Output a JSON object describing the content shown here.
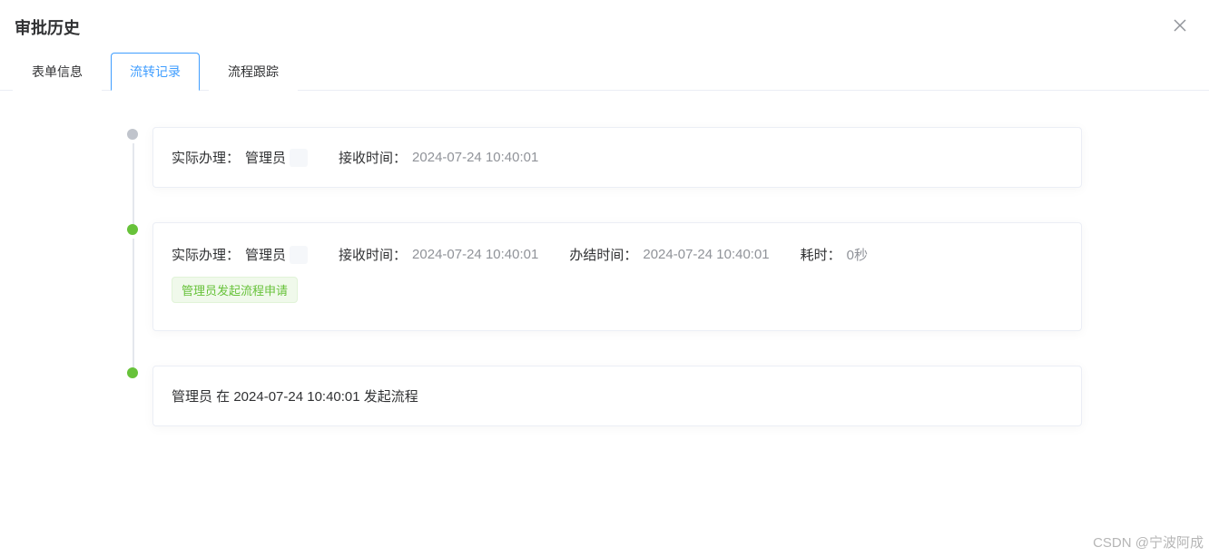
{
  "dialog": {
    "title": "审批历史"
  },
  "tabs": [
    {
      "label": "表单信息",
      "active": false
    },
    {
      "label": "流转记录",
      "active": true
    },
    {
      "label": "流程跟踪",
      "active": false
    }
  ],
  "labels": {
    "handler": "实际办理：",
    "receive_time": "接收时间：",
    "finish_time": "办结时间：",
    "duration": "耗时："
  },
  "timeline": [
    {
      "dot": "grey",
      "handler": "管理员",
      "receive_time": "2024-07-24 10:40:01"
    },
    {
      "dot": "green",
      "handler": "管理员",
      "receive_time": "2024-07-24 10:40:01",
      "finish_time": "2024-07-24 10:40:01",
      "duration": "0秒",
      "tag": "管理员发起流程申请"
    },
    {
      "dot": "green",
      "text": "管理员 在 2024-07-24 10:40:01 发起流程"
    }
  ],
  "watermark": "CSDN @宁波阿成"
}
